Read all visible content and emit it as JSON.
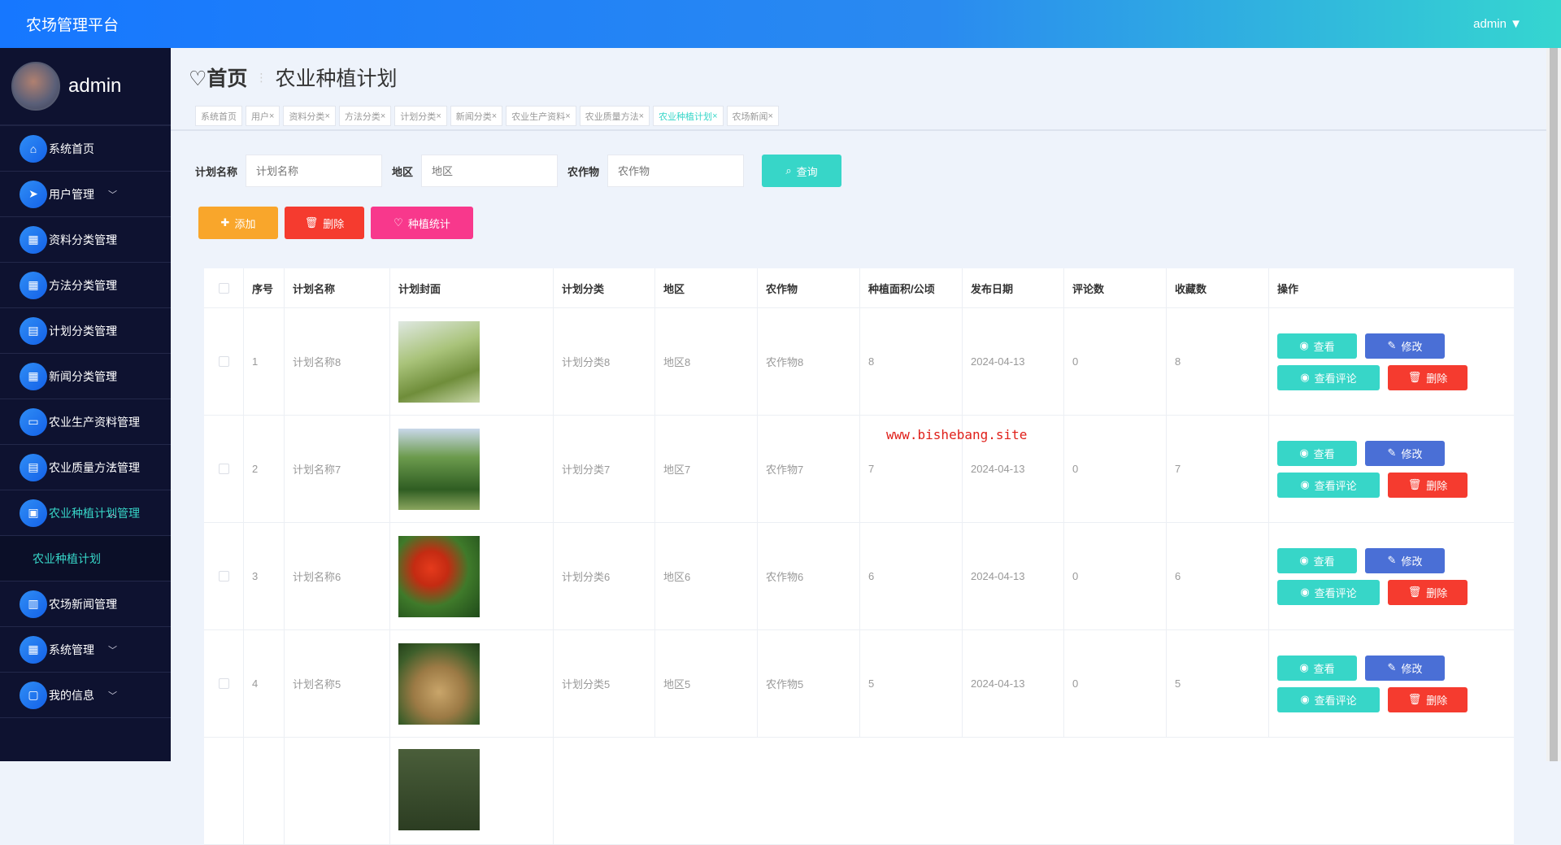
{
  "app": {
    "title": "农场管理平台",
    "user": "admin"
  },
  "sidebar": {
    "username": "admin",
    "items": [
      {
        "label": "系统首页",
        "icon": "home-icon",
        "expandable": false
      },
      {
        "label": "用户管理",
        "icon": "send-icon",
        "expandable": true
      },
      {
        "label": "资料分类管理",
        "icon": "grid-icon",
        "expandable": true
      },
      {
        "label": "方法分类管理",
        "icon": "grid-icon",
        "expandable": true
      },
      {
        "label": "计划分类管理",
        "icon": "clipboard-icon",
        "expandable": true
      },
      {
        "label": "新闻分类管理",
        "icon": "grid-icon",
        "expandable": true
      },
      {
        "label": "农业生产资料管理",
        "icon": "monitor-icon",
        "expandable": true
      },
      {
        "label": "农业质量方法管理",
        "icon": "clipboard-icon",
        "expandable": true
      },
      {
        "label": "农业种植计划管理",
        "icon": "image-icon",
        "expandable": true,
        "active": true
      },
      {
        "label": "农场新闻管理",
        "icon": "book-icon",
        "expandable": true
      },
      {
        "label": "系统管理",
        "icon": "grid-icon",
        "expandable": true
      },
      {
        "label": "我的信息",
        "icon": "wallet-icon",
        "expandable": true
      }
    ],
    "sub_item": "农业种植计划"
  },
  "breadcrumb": {
    "home": "首页",
    "current": "农业种植计划"
  },
  "tabs": [
    "系统首页",
    "用户",
    "资料分类",
    "方法分类",
    "计划分类",
    "新闻分类",
    "农业生产资料",
    "农业质量方法",
    "农业种植计划",
    "农场新闻"
  ],
  "search": {
    "name_label": "计划名称",
    "name_placeholder": "计划名称",
    "region_label": "地区",
    "region_placeholder": "地区",
    "crop_label": "农作物",
    "crop_placeholder": "农作物",
    "query": "查询"
  },
  "actions": {
    "add": "添加",
    "delete": "删除",
    "stats": "种植统计",
    "add_color": "#f9a62b",
    "delete_color": "#f53b2f",
    "stats_color": "#f8388c"
  },
  "table": {
    "headers": [
      "序号",
      "计划名称",
      "计划封面",
      "计划分类",
      "地区",
      "农作物",
      "种植面积/公顷",
      "发布日期",
      "评论数",
      "收藏数",
      "操作"
    ],
    "rows": [
      {
        "no": "1",
        "name": "计划名称8",
        "category": "计划分类8",
        "region": "地区8",
        "crop": "农作物8",
        "area": "8",
        "date": "2024-04-13",
        "comments": "0",
        "favorites": "8"
      },
      {
        "no": "2",
        "name": "计划名称7",
        "category": "计划分类7",
        "region": "地区7",
        "crop": "农作物7",
        "area": "7",
        "date": "2024-04-13",
        "comments": "0",
        "favorites": "7"
      },
      {
        "no": "3",
        "name": "计划名称6",
        "category": "计划分类6",
        "region": "地区6",
        "crop": "农作物6",
        "area": "6",
        "date": "2024-04-13",
        "comments": "0",
        "favorites": "6"
      },
      {
        "no": "4",
        "name": "计划名称5",
        "category": "计划分类5",
        "region": "地区5",
        "crop": "农作物5",
        "area": "5",
        "date": "2024-04-13",
        "comments": "0",
        "favorites": "5"
      }
    ],
    "ops": {
      "view": "查看",
      "edit": "修改",
      "comments": "查看评论",
      "delete": "删除"
    }
  },
  "watermark": "www.bishebang.site"
}
